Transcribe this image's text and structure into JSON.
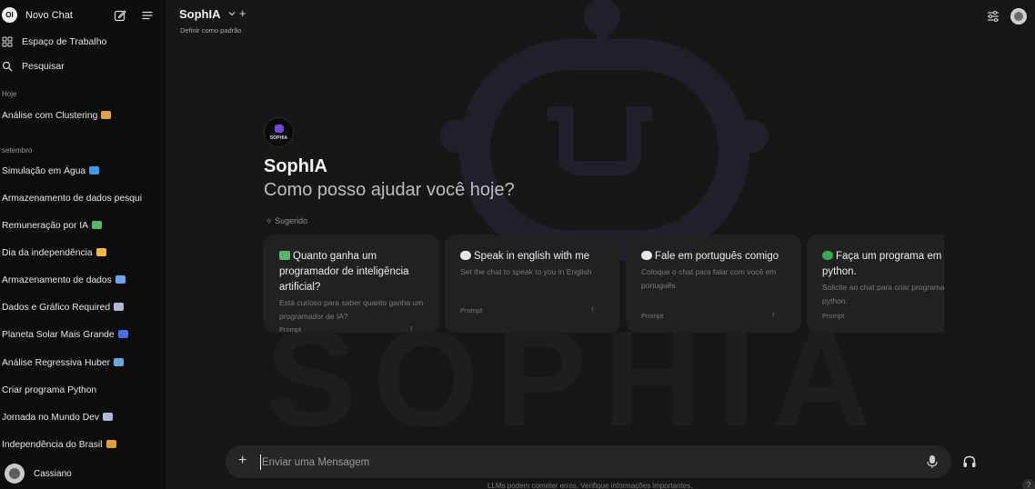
{
  "sidebar": {
    "logo_text": "OI",
    "new_chat": "Novo Chat",
    "workspace": "Espaço de Trabalho",
    "search": "Pesquisar",
    "section_today": "Hoje",
    "today_items": [
      {
        "label": "Análise com Clustering",
        "emoji_color": "#e0a050"
      }
    ],
    "section_september": "setembro",
    "september_items": [
      {
        "label": "Simulação em Água",
        "emoji_color": "#3d9be9"
      },
      {
        "label": "Armazenamento de dados pesqui",
        "emoji_color": ""
      },
      {
        "label": "Remuneração por IA",
        "emoji_color": "#5bb46a"
      },
      {
        "label": "Dia da independência",
        "emoji_color": "#f0b840"
      },
      {
        "label": "Armazenamento de dados",
        "emoji_color": "#6aa8e8"
      },
      {
        "label": "Dados e Gráfico Required",
        "emoji_color": "#b0b8d8"
      },
      {
        "label": "Planeta Solar Mais Grande",
        "emoji_color": "#4a70e0"
      },
      {
        "label": "Análise Regressiva Huber",
        "emoji_color": "#6aa8d8"
      },
      {
        "label": "Criar programa Python",
        "emoji_color": ""
      },
      {
        "label": "Jornada no Mundo Dev",
        "emoji_color": "#b0b8d8"
      },
      {
        "label": "Independência do Brasil",
        "emoji_color": "#e0a040"
      }
    ],
    "user_name": "Cassiano"
  },
  "header": {
    "model_name": "SophIA",
    "set_default": "Definir como padrão"
  },
  "welcome": {
    "logo_text": "SOPHIA",
    "title": "SophIA",
    "subtitle": "Como posso ajudar você hoje?",
    "suggested_label": "Sugerido"
  },
  "cards": [
    {
      "title": "Quanto ganha um programador de inteligência artificial?",
      "desc": "Está curioso para saber quanto ganha um programador de IA?",
      "prompt": "Prompt",
      "emoji_color": "#5bb46a"
    },
    {
      "title": "Speak in english with me",
      "desc": "Set the chat to speak to you in English",
      "prompt": "Prompt",
      "emoji_color": "#e8e8e8"
    },
    {
      "title": "Fale em português comigo",
      "desc": "Coloque o chat para falar com você em português",
      "prompt": "Prompt",
      "emoji_color": "#e8e8e8"
    },
    {
      "title": "Faça um programa em python.",
      "desc": "Solicite ao chat para criar programas em python.",
      "prompt": "Prompt",
      "emoji_color": "#3fa855"
    }
  ],
  "input": {
    "placeholder": "Enviar uma Mensagem"
  },
  "footer": {
    "note": "LLMs podem cometer erros. Verifique informações importantes.",
    "help": "?"
  },
  "background": {
    "watermark": "SOPHIA"
  }
}
